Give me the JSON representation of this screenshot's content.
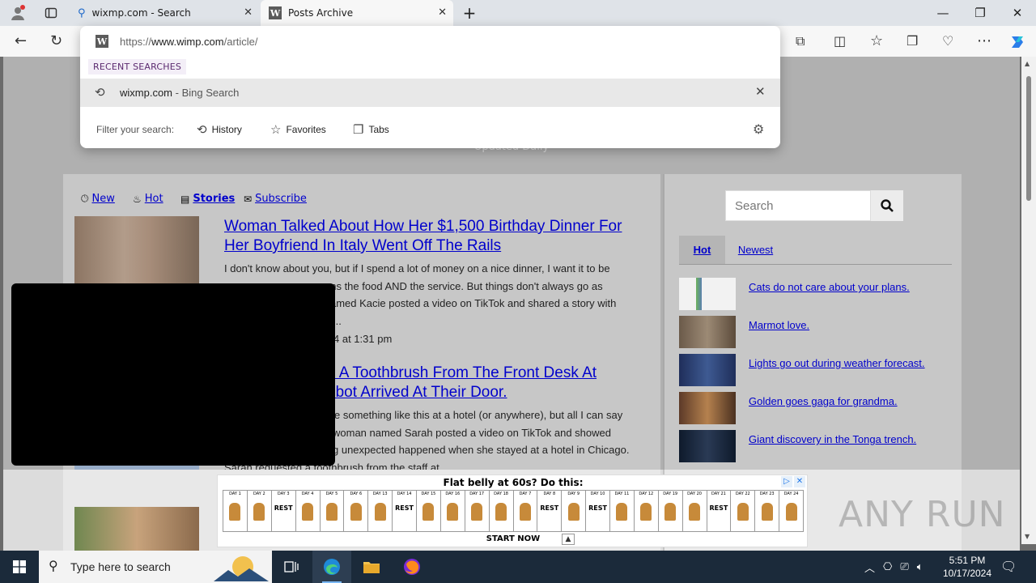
{
  "browser": {
    "tabs": [
      {
        "title": "wixmp.com - Search",
        "favicon": "search-icon"
      },
      {
        "title": "Posts Archive",
        "favicon": "w-site-icon"
      }
    ],
    "new_tab_symbol": "+",
    "window_controls": {
      "minimize": "—",
      "restore": "❐",
      "close": "✕"
    }
  },
  "omnibox": {
    "url_prefix": "https://",
    "url_host": "www.wimp.com",
    "url_path": "/article/",
    "recent_label": "RECENT SEARCHES",
    "suggestion": {
      "text": "wixmp.com",
      "subtext": " - Bing Search"
    },
    "filter_label": "Filter your search:",
    "filters": [
      "History",
      "Favorites",
      "Tabs"
    ]
  },
  "site": {
    "tagline": "Updated Daily",
    "nav": [
      "New",
      "Hot",
      "Stories",
      "Subscribe"
    ],
    "articles": [
      {
        "title": "Woman Talked About How Her $1,500 Birthday Dinner For Her Boyfriend In Italy Went Off The Rails",
        "excerpt_lines": [
          "I don't know about you, but if I spend a lot of money on a nice dinner, I want it to be",
          "ans the food AND the service. But things don't always go as",
          "amed Kacie posted a video on TikTok and shared a story with",
          "..."
        ],
        "date": "4 at 1:31 pm"
      },
      {
        "title_lines": [
          "d A Toothbrush From The Front Desk At",
          "obot Arrived At Their Door."
        ],
        "excerpt_lines": [
          "e something like this at a hotel (or anywhere), but all I can say",
          "woman named Sarah posted a video on TikTok and showed",
          "g unexpected happened when she stayed at a hotel in Chicago.",
          "Sarah requested a toothbrush from the staff at..."
        ]
      }
    ],
    "sidebar": {
      "search_placeholder": "Search",
      "tabs": [
        "Hot",
        "Newest"
      ],
      "items": [
        "Cats do not care about your plans.",
        "Marmot love.",
        "Lights go out during weather forecast.",
        "Golden goes gaga for grandma.",
        "Giant discovery in the Tonga trench."
      ]
    }
  },
  "ad": {
    "headline": "Flat belly at 60s? Do this:",
    "days": [
      "DAY 1",
      "DAY 2",
      "DAY 3",
      "DAY 4",
      "DAY 5",
      "DAY 6",
      "DAY 13",
      "DAY 14",
      "DAY 15",
      "DAY 16",
      "DAY 17",
      "DAY 18",
      "DAY 7",
      "DAY 8",
      "DAY 9",
      "DAY 10",
      "DAY 11",
      "DAY 12",
      "DAY 19",
      "DAY 20",
      "DAY 21",
      "DAY 22",
      "DAY 23",
      "DAY 24"
    ],
    "rest_days": [
      "DAY 3",
      "DAY 14",
      "DAY 8",
      "DAY 10",
      "DAY 21"
    ],
    "rest_label": "REST",
    "cta": "START NOW"
  },
  "watermark": "ANY RUN",
  "taskbar": {
    "search_placeholder": "Type here to search",
    "time": "5:51 PM",
    "date": "10/17/2024"
  },
  "colors": {
    "link": "#0000cc",
    "taskbar": "#1b2a3a",
    "overlay_dim": "#b0b0b0"
  }
}
